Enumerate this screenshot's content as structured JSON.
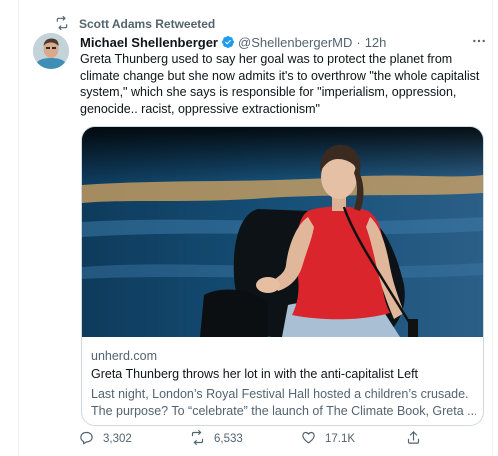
{
  "retweet_banner": {
    "text": "Scott Adams Retweeted"
  },
  "tweet": {
    "author_name": "Michael Shellenberger",
    "author_handle": "@ShellenbergerMD",
    "separator": "·",
    "time": "12h",
    "text": "Greta Thunberg used to say her goal was to protect the planet from climate change but she now admits it's to overthrow \"the whole capitalist system,\" which she says is responsible for \"imperialism, oppression, genocide.. racist, oppressive extractionism\""
  },
  "card": {
    "domain": "unherd.com",
    "title": "Greta Thunberg throws her lot in with the anti-capitalist Left",
    "description_line1": "Last night, London’s Royal Festival Hall hosted a children’s crusade.",
    "description_line2": "The purpose? To “celebrate” the launch of The Climate Book, Greta ..."
  },
  "actions": {
    "reply_count": "3,302",
    "retweet_count": "6,533",
    "like_count": "17.1K"
  },
  "icons": {
    "retweet_banner": "retweet-icon",
    "verified": "verified-badge-icon",
    "more": "more-horizontal-icon",
    "reply": "reply-icon",
    "retweet": "retweet-icon",
    "like": "heart-icon",
    "share": "share-icon"
  },
  "colors": {
    "text_primary": "#0f1419",
    "text_secondary": "#536471",
    "verified_blue": "#1d9bf0",
    "border": "#cfd9de"
  }
}
